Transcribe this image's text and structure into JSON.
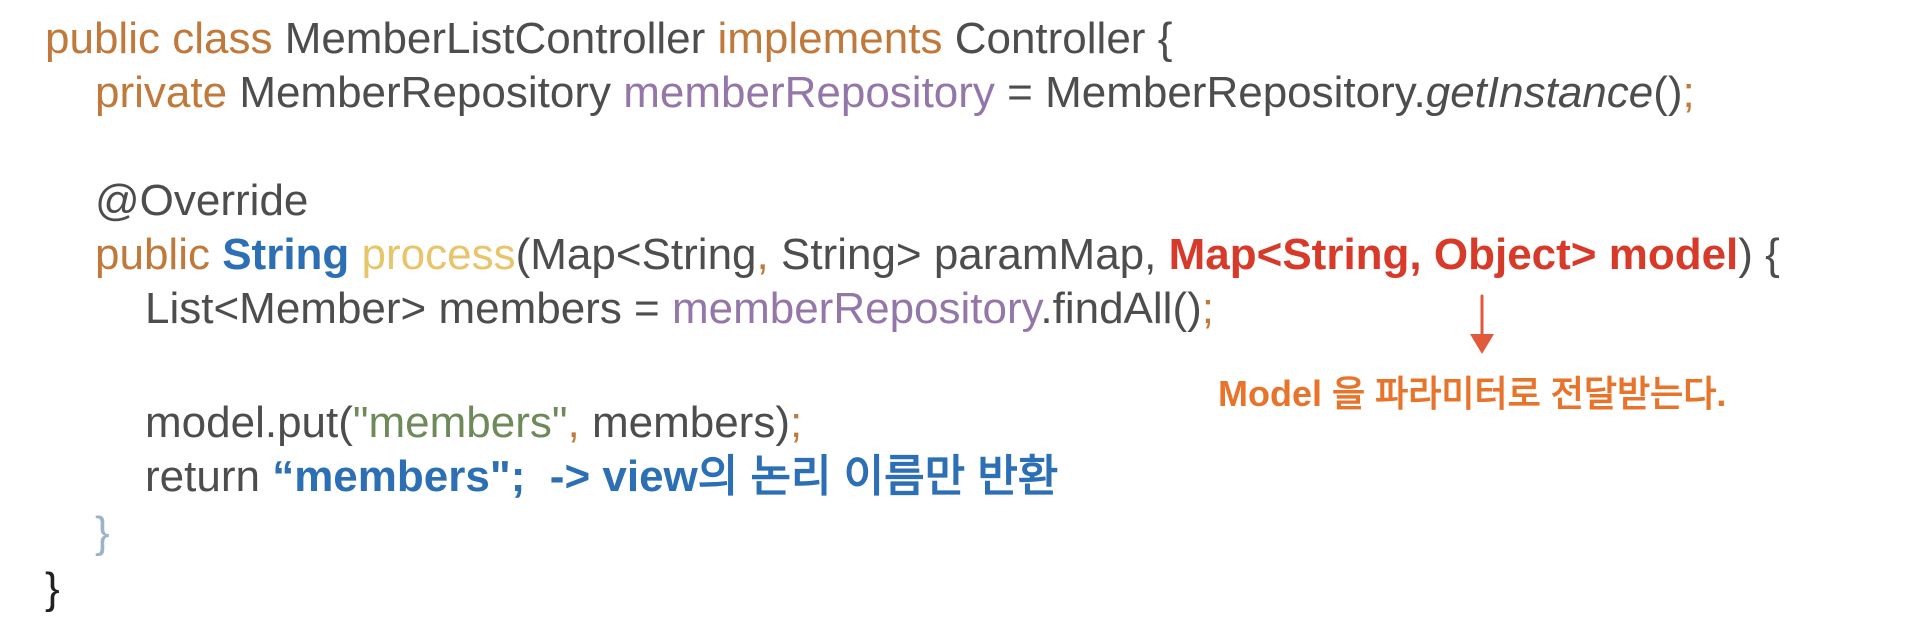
{
  "code": {
    "line1": {
      "kw_public": "public",
      "kw_class": "class",
      "class_name": "MemberListController",
      "kw_implements": "implements",
      "interface_name": "Controller",
      "open_brace": "{"
    },
    "line2": {
      "kw_private": "private",
      "type": "MemberRepository",
      "field": "memberRepository",
      "assign": "=",
      "call_target": "MemberRepository.",
      "method": "getInstance",
      "parens": "()",
      "semicolon": ";"
    },
    "line4": {
      "annotation": "@Override"
    },
    "line5": {
      "kw_public": "public",
      "return_type": "String",
      "method_name": "process",
      "open_paren": "(",
      "param1": "Map<String",
      "comma1": ",",
      "param1b": " String> paramMap",
      "comma2": ",",
      "param2": "Map<String, Object> model",
      "close": ") {"
    },
    "line6": {
      "decl": "List<Member> members = ",
      "field": "memberRepository",
      "call": ".findAll()",
      "semicolon": ";"
    },
    "line8": {
      "call": "model.put(",
      "string": "\"members\"",
      "comma": ",",
      "rest": " members)",
      "semicolon": ";"
    },
    "line9": {
      "kw_return": "return",
      "return_value": "“members\";  -> view의 논리 이름만 반환"
    },
    "line10": {
      "close_brace": "}"
    },
    "line11": {
      "close_brace": "}"
    }
  },
  "annotation": {
    "text": "Model 을 파라미터로 전달받는다.",
    "color": "#e8742b",
    "arrow_color": "#e25a3c"
  },
  "colors": {
    "keyword": "#c0793a",
    "method_name": "#e8c46a",
    "field": "#9476a8",
    "string": "#6f8a5a",
    "highlight_blue": "#2c6fb4",
    "highlight_red": "#d83a2a",
    "plain": "#4d4d4d"
  }
}
